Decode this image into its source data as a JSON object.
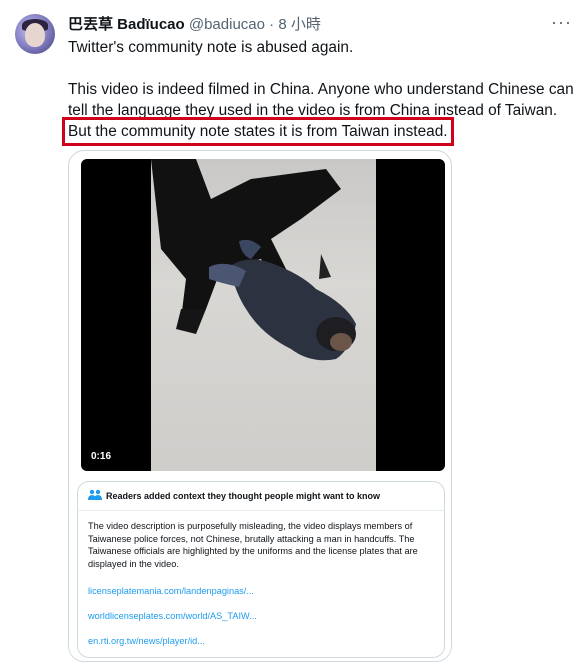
{
  "tweet": {
    "author_name": "巴丟草 Badïucao",
    "author_handle": "@badiucao",
    "dot": "·",
    "time": "8 小時",
    "more": "···",
    "line1": "Twitter's community note is abused again.",
    "line2": "This video is indeed filmed in China. Anyone who understand Chinese can",
    "line3": "tell the language they used in the video is from China  instead of Taiwan.",
    "line4": "But the community note states it is from Taiwan instead."
  },
  "video": {
    "duration": "0:16"
  },
  "community_note": {
    "icon": "people-icon",
    "title": "Readers added context they thought people might want to know",
    "body": "The video description is purposefully misleading, the video displays members of Taiwanese police forces, not Chinese, brutally attacking a man in handcuffs. The Taiwanese officials are highlighted by the uniforms and the license plates that are displayed in the video.",
    "links": [
      "licenseplatemania.com/landenpaginas/...",
      "worldlicenseplates.com/world/AS_TAIW...",
      "en.rti.org.tw/news/player/id..."
    ]
  },
  "colors": {
    "highlight_box": "#d0021b",
    "link": "#1d9bf0",
    "secondary_text": "#536471"
  }
}
